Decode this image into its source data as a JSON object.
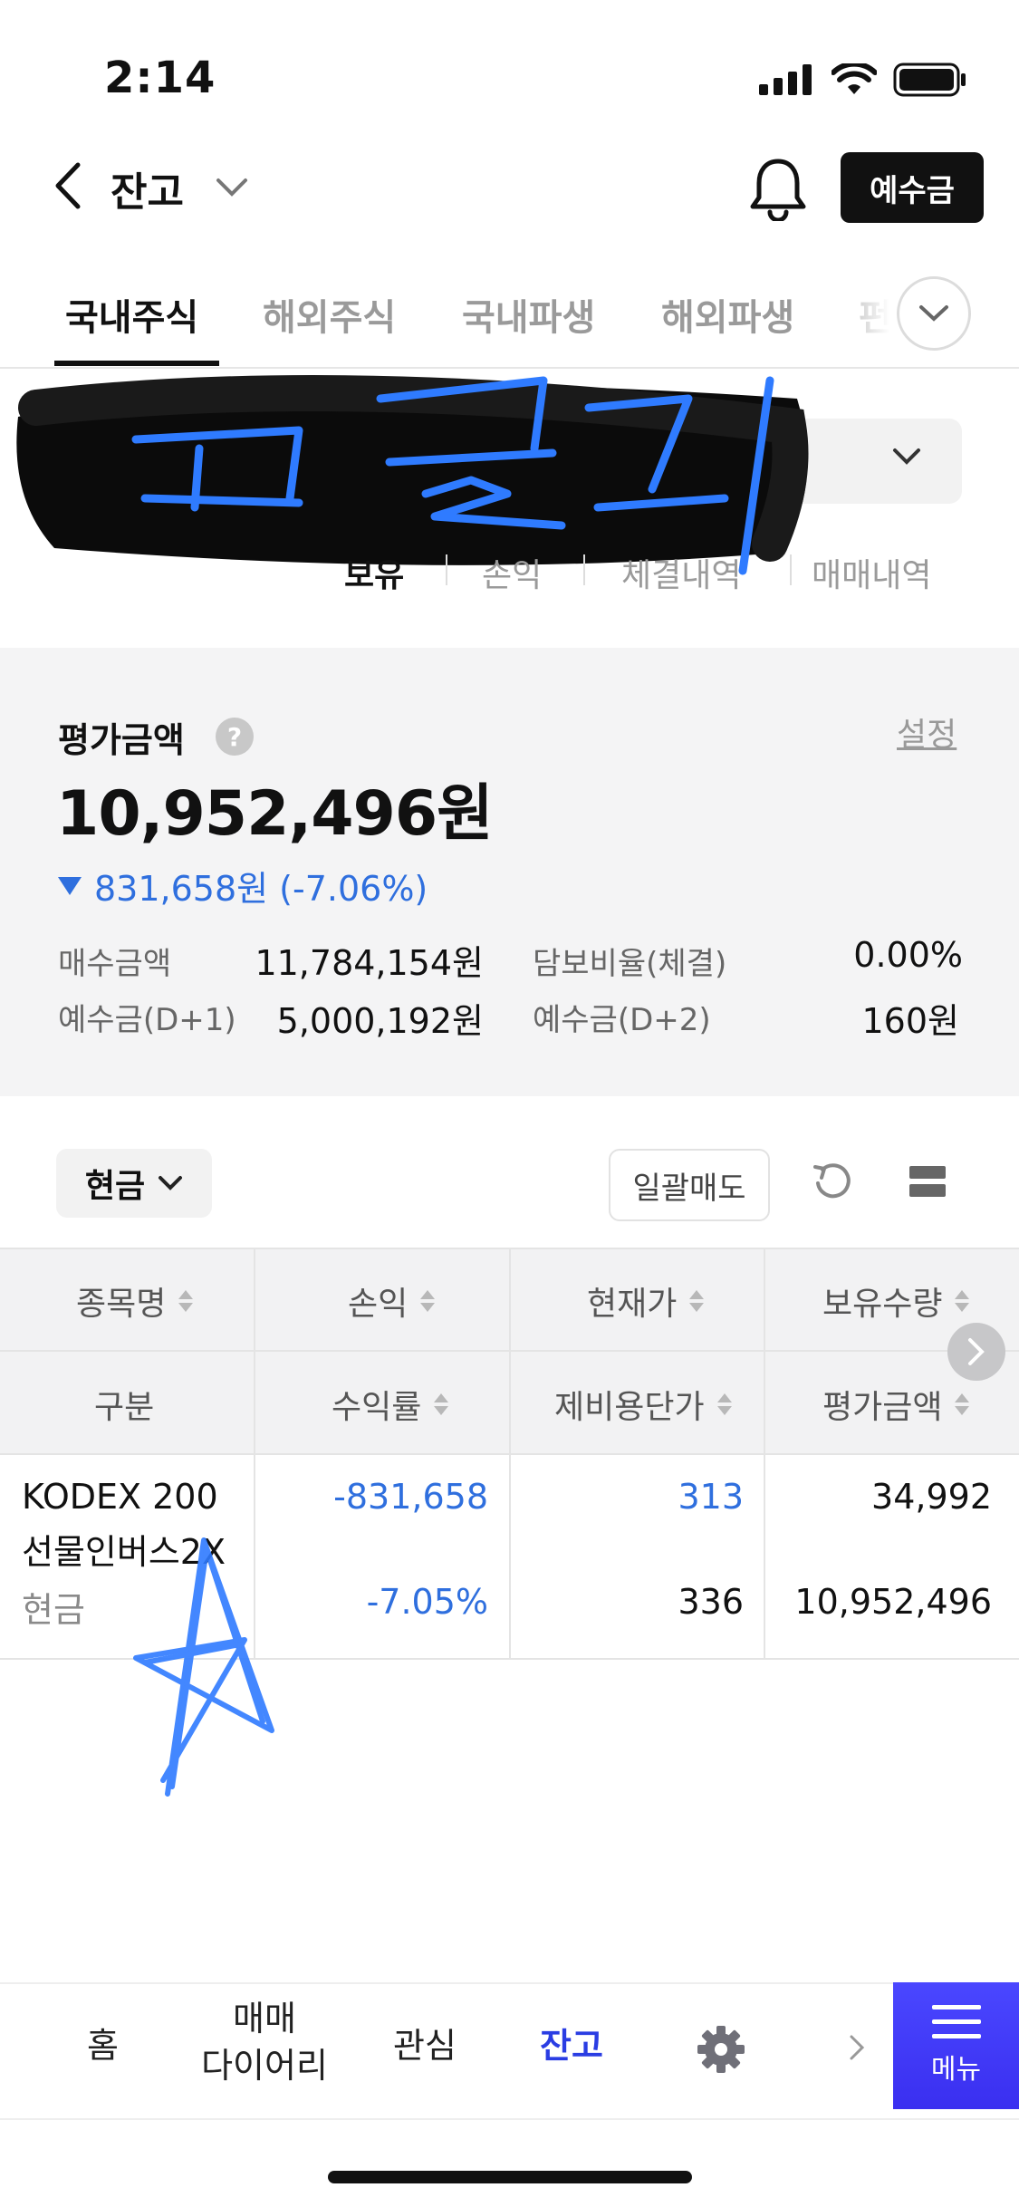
{
  "status_bar": {
    "time": "2:14"
  },
  "header": {
    "title": "잔고",
    "deposit_button": "예수금"
  },
  "tabs": [
    {
      "label": "국내주식",
      "active": true
    },
    {
      "label": "해외주식",
      "active": false
    },
    {
      "label": "국내파생",
      "active": false
    },
    {
      "label": "해외파생",
      "active": false
    },
    {
      "label": "펀",
      "active": false
    }
  ],
  "scribble_text": "코긍키",
  "sub_tabs": [
    {
      "label": "보유",
      "active": true
    },
    {
      "label": "손익",
      "active": false
    },
    {
      "label": "체결내역",
      "active": false
    },
    {
      "label": "매매내역",
      "active": false
    }
  ],
  "summary": {
    "eval_label": "평가금액",
    "help": "?",
    "settings": "설정",
    "eval_amount": "10,952,496원",
    "change": "831,658원 (-7.06%)",
    "rows": [
      {
        "label1": "매수금액",
        "value1": "11,784,154원",
        "label2": "담보비율(체결)",
        "value2": "0.00%"
      },
      {
        "label1": "예수금(D+1)",
        "value1": "5,000,192원",
        "label2": "예수금(D+2)",
        "value2": "160원"
      }
    ]
  },
  "toolbar": {
    "cash_select": "현금",
    "bulk_sell": "일괄매도"
  },
  "table": {
    "header_row1": [
      "종목명",
      "손익",
      "현재가",
      "보유수량"
    ],
    "header_row2": [
      "구분",
      "수익률",
      "제비용단가",
      "평가금액"
    ],
    "rows": [
      {
        "name_line1": "KODEX 200",
        "name_line2": "선물인버스2X",
        "type": "현금",
        "pnl": "-831,658",
        "return_rate": "-7.05%",
        "current_price": "313",
        "cost_price": "336",
        "quantity": "34,992",
        "eval_amount": "10,952,496"
      }
    ]
  },
  "bottom_nav": {
    "home": "홈",
    "diary_line1": "매매",
    "diary_line2": "다이어리",
    "watch": "관심",
    "balance": "잔고",
    "menu": "메뉴"
  },
  "colors": {
    "accent_blue": "#2f6fde",
    "menu_purple": "#3d38f2",
    "active_nav": "#2a3de3"
  }
}
